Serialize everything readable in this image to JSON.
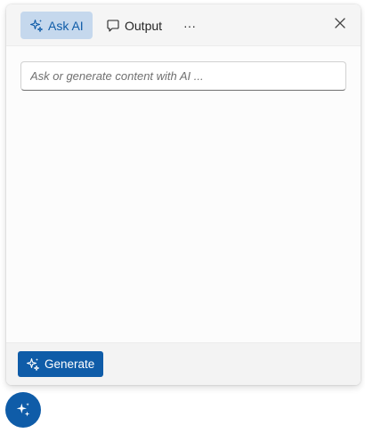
{
  "header": {
    "tabs": [
      {
        "label": "Ask AI",
        "icon": "sparkle-icon",
        "active": true
      },
      {
        "label": "Output",
        "icon": "comment-icon",
        "active": false
      }
    ],
    "more_label": "···",
    "close_icon": "close-icon"
  },
  "prompt": {
    "placeholder": "Ask or generate content with AI ...",
    "value": ""
  },
  "footer": {
    "generate_label": "Generate",
    "generate_icon": "sparkle-icon"
  },
  "fab": {
    "icon": "sparkle-icon"
  },
  "colors": {
    "accent": "#0f5ca8",
    "active_tab_bg": "#c5d8ed",
    "header_bg": "#f5f5f5",
    "footer_bg": "#f3f3f3"
  }
}
